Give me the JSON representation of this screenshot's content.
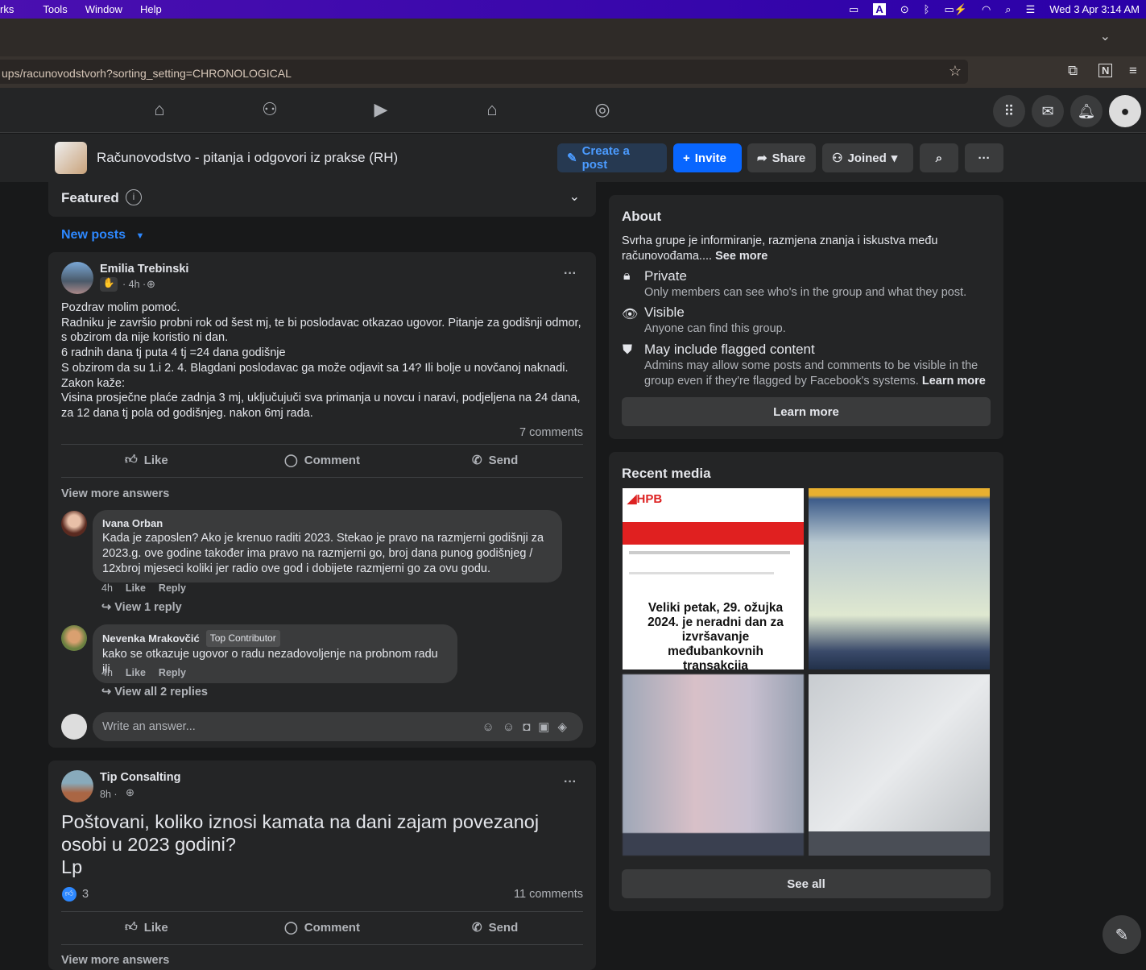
{
  "menubar": {
    "items": [
      "rks",
      "Tools",
      "Window",
      "Help"
    ],
    "clock": "Wed 3 Apr  3:14 AM"
  },
  "browser": {
    "url": "ups/racunovodstvorh?sorting_setting=CHRONOLOGICAL"
  },
  "fbnav": {
    "icons": [
      "home-icon",
      "friends-icon",
      "video-icon",
      "marketplace-icon",
      "gaming-icon"
    ]
  },
  "group": {
    "name": "Računovodstvo - pitanja i odgovori iz prakse (RH)",
    "buttons": {
      "create": "Create a post",
      "invite": "Invite",
      "share": "Share",
      "joined": "Joined"
    }
  },
  "feed": {
    "featured": "Featured",
    "sort": "New posts"
  },
  "post1": {
    "author": "Emilia Trebinski",
    "time": "· 4h ·",
    "lines": [
      "Pozdrav molim pomoć.",
      "Radniku je završio probni rok od šest mj, te bi poslodavac otkazao ugovor. Pitanje za godišnji odmor, s obzirom da nije koristio ni dan.",
      "6 radnih dana tj puta 4 tj =24 dana godišnje",
      "S obzirom da su 1.i 2. 4. Blagdani poslodavac ga može odjavit sa 14? Ili bolje u novčanoj naknadi.",
      "Zakon kaže:",
      "Visina prosječne plaće zadnja 3 mj, uključujuči sva primanja u novcu i naravi, podjeljena na 24 dana, za 12 dana tj pola od godišnjeg. nakon 6mj rada."
    ],
    "comments": "7 comments",
    "like": "Like",
    "comment": "Comment",
    "send": "Send",
    "view_more": "View more answers",
    "replies": [
      {
        "author": "Ivana Orban",
        "text": "Kada je zaposlen? Ako je krenuo raditi 2023. Stekao je pravo na razmjerni godišnji za 2023.g. ove godine također ima pravo na razmjerni go, broj dana punog godišnjeg / 12xbroj mjeseci koliki jer radio ove god i dobijete razmjerni go za ovu godu.",
        "time": "4h",
        "like": "Like",
        "reply": "Reply",
        "view": "View 1 reply"
      },
      {
        "author": "Nevenka Mrakovčić",
        "badge": "Top Contributor",
        "text": "kako se otkazuje ugovor o radu nezadovoljenje na probnom radu ili",
        "time": "4h",
        "like": "Like",
        "reply": "Reply",
        "view": "View all 2 replies"
      }
    ],
    "answer_placeholder": "Write an answer..."
  },
  "post2": {
    "author": "Tip Consalting",
    "time": "8h  ·",
    "text": "Poštovani, koliko iznosi kamata na dani zajam povezanoj osobi u 2023 godini?",
    "sign": "Lp",
    "reactions": "3",
    "comments": "11 comments",
    "like": "Like",
    "comment": "Comment",
    "send": "Send",
    "view_more": "View more answers"
  },
  "about": {
    "title": "About",
    "desc": "Svrha grupe je informiranje, razmjena znanja i iskustva među računovođama....",
    "see_more": "See more",
    "items": [
      {
        "icon": "lock-icon",
        "title": "Private",
        "text": "Only members can see who's in the group and what they post."
      },
      {
        "icon": "eye-icon",
        "title": "Visible",
        "text": "Anyone can find this group."
      },
      {
        "icon": "shield-icon",
        "title": "May include flagged content",
        "text": "Admins may allow some posts and comments to be visible in the group even if they're flagged by Facebook's systems.",
        "link": "Learn more"
      }
    ],
    "learn_more": "Learn more"
  },
  "media": {
    "title": "Recent media",
    "hpb_logo": "HPB",
    "hpb_headline": "Veliki petak, 29. ožujka 2024. je neradni dan za izvršavanje međubankovnih transakcija",
    "see_all": "See all"
  },
  "colors": {
    "accent": "#2d88ff",
    "button_blue": "#0866ff",
    "card": "#242526",
    "bg": "#18191a"
  }
}
